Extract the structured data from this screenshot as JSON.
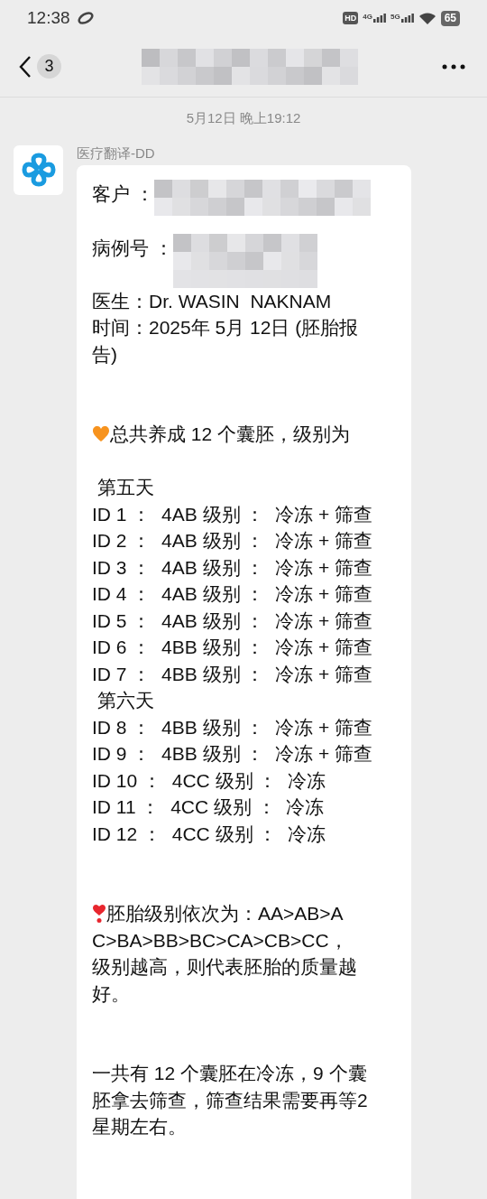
{
  "status_bar": {
    "time": "12:38",
    "hd": "HD",
    "networks": [
      "4G",
      "5G"
    ],
    "battery": "65"
  },
  "header": {
    "unread_count": "3"
  },
  "date_divider": "5月12日 晚上19:12",
  "message": {
    "sender": "医疗翻译-DD",
    "lines": [
      {
        "kind": "redacted",
        "text": "客户 ："
      },
      {
        "kind": "redacted",
        "text": "病例号 ："
      },
      {
        "kind": "text",
        "text": "医生：Dr. WASIN  NAKNAM"
      },
      {
        "kind": "text",
        "text": "时间：2025年 5月 12日 (胚胎报"
      },
      {
        "kind": "text",
        "text": "告)"
      },
      {
        "kind": "space"
      },
      {
        "kind": "space"
      },
      {
        "kind": "heart",
        "text": "总共养成 12 个囊胚，级别为"
      },
      {
        "kind": "space"
      },
      {
        "kind": "text",
        "text": " 第五天"
      },
      {
        "kind": "text",
        "text": "ID 1 ：  4AB 级别 ：  冷冻 + 筛查"
      },
      {
        "kind": "text",
        "text": "ID 2 ：  4AB 级别 ：  冷冻 + 筛查"
      },
      {
        "kind": "text",
        "text": "ID 3 ：  4AB 级别 ：  冷冻 + 筛查"
      },
      {
        "kind": "text",
        "text": "ID 4 ：  4AB 级别 ：  冷冻 + 筛查"
      },
      {
        "kind": "text",
        "text": "ID 5 ：  4AB 级别 ：  冷冻 + 筛查"
      },
      {
        "kind": "text",
        "text": "ID 6 ：  4BB 级别 ：  冷冻 + 筛查"
      },
      {
        "kind": "text",
        "text": "ID 7 ：  4BB 级别 ：  冷冻 + 筛查"
      },
      {
        "kind": "text",
        "text": " 第六天"
      },
      {
        "kind": "text",
        "text": "ID 8 ：  4BB 级别 ：  冷冻 + 筛查"
      },
      {
        "kind": "text",
        "text": "ID 9 ：  4BB 级别 ：  冷冻 + 筛查"
      },
      {
        "kind": "text",
        "text": "ID 10 ：  4CC 级别 ：  冷冻"
      },
      {
        "kind": "text",
        "text": "ID 11 ：  4CC 级别 ：  冷冻"
      },
      {
        "kind": "text",
        "text": "ID 12 ：  4CC 级别 ：  冷冻"
      },
      {
        "kind": "space"
      },
      {
        "kind": "space"
      },
      {
        "kind": "alert",
        "text": "胚胎级别依次为：AA>AB>A"
      },
      {
        "kind": "text",
        "text": "C>BA>BB>BC>CA>CB>CC，"
      },
      {
        "kind": "text",
        "text": "级别越高，则代表胚胎的质量越"
      },
      {
        "kind": "text",
        "text": "好。"
      },
      {
        "kind": "space"
      },
      {
        "kind": "space"
      },
      {
        "kind": "text",
        "text": "一共有 12 个囊胚在冷冻，9 个囊"
      },
      {
        "kind": "text",
        "text": "胚拿去筛查，筛查结果需要再等2"
      },
      {
        "kind": "text",
        "text": "星期左右。"
      }
    ]
  }
}
